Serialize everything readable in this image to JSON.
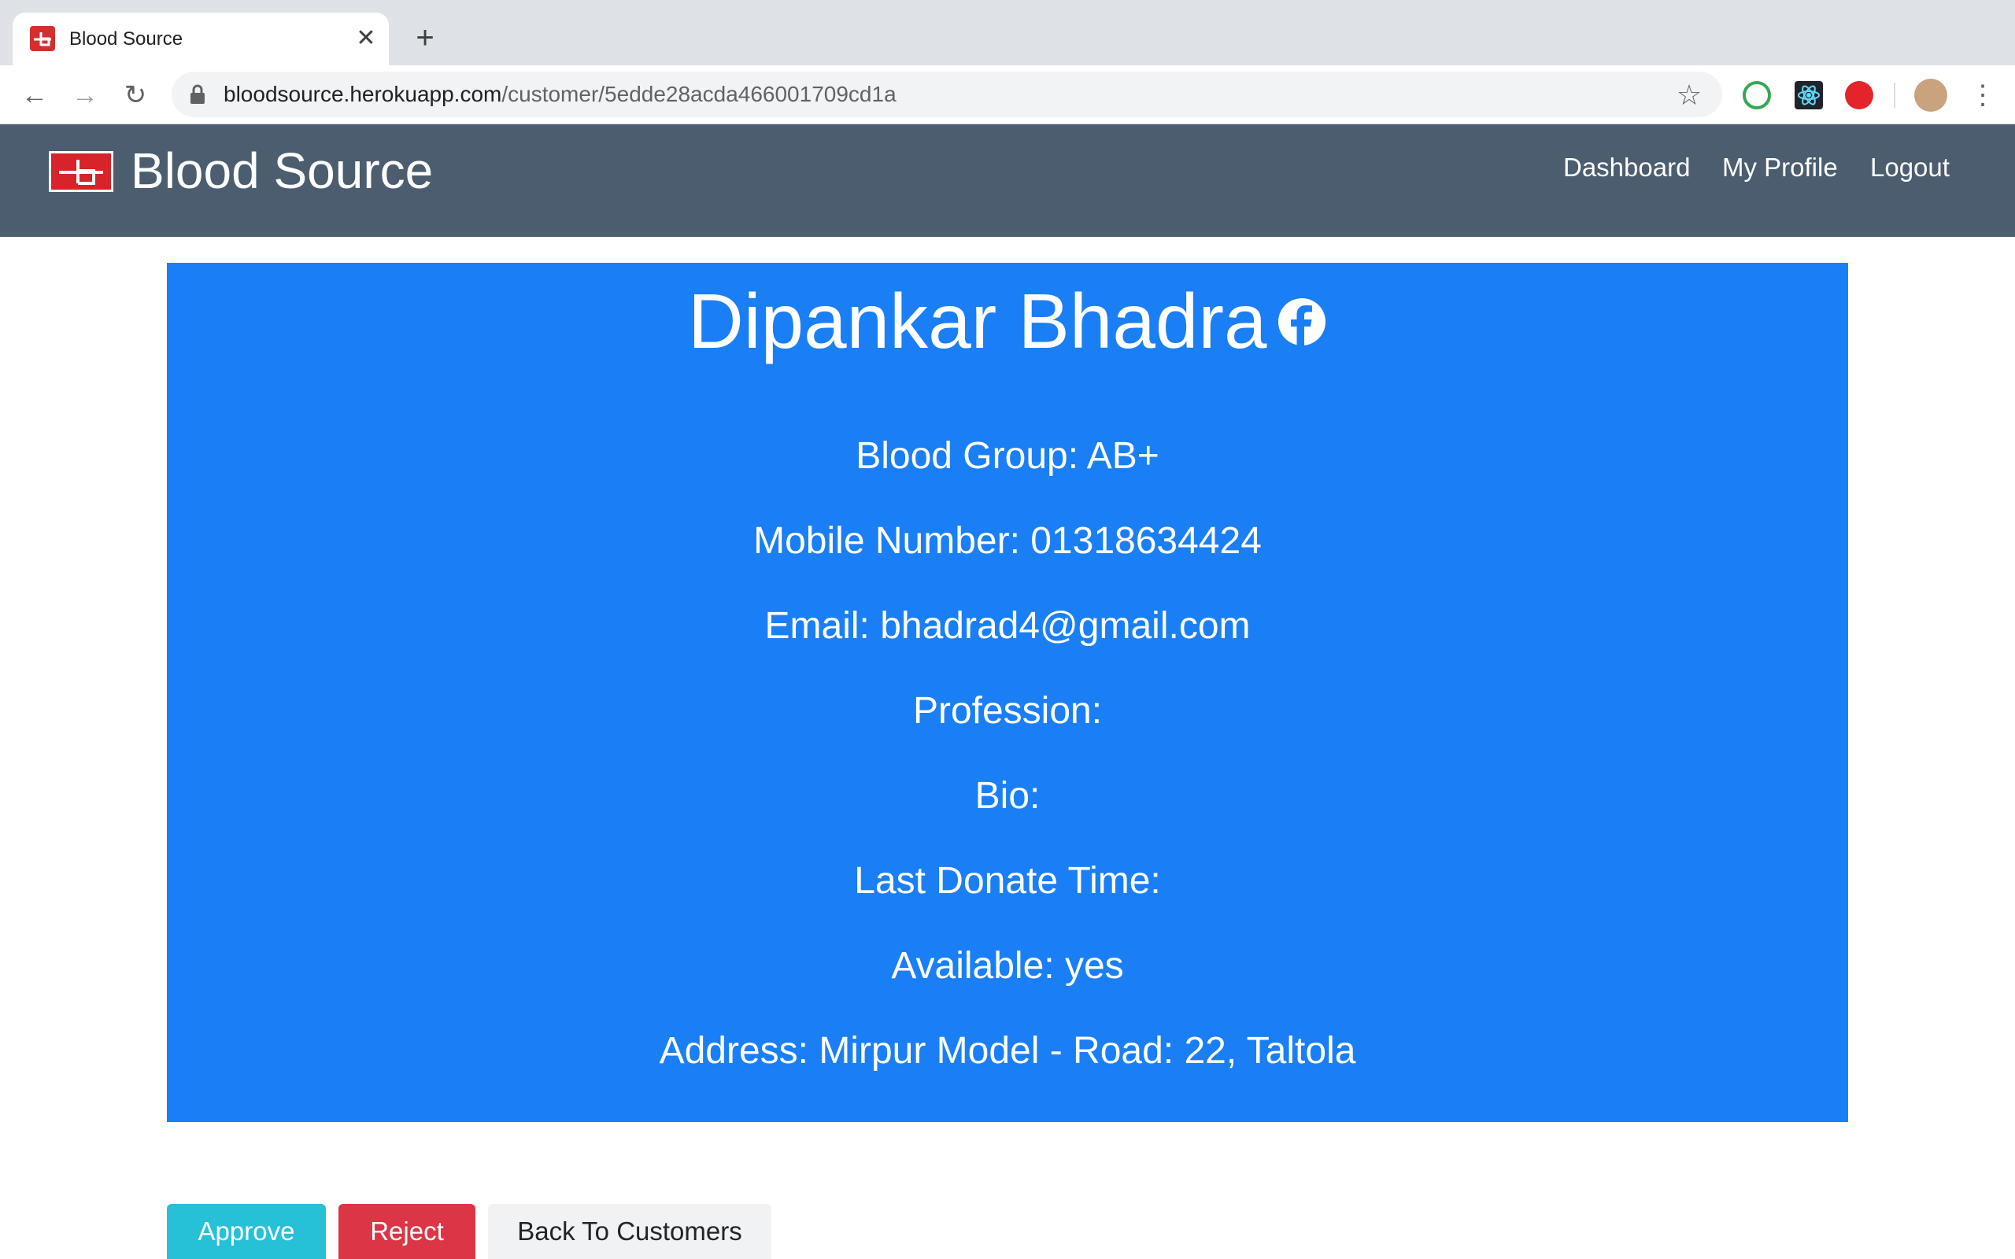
{
  "browser": {
    "tab_title": "Blood Source",
    "tab_close": "✕",
    "new_tab": "+",
    "url_host": "bloodsource.herokuapp.com",
    "url_path": "/customer/5edde28acda466001709cd1a",
    "back": "←",
    "forward": "→",
    "reload": "↻",
    "star": "☆",
    "menu": "⋮"
  },
  "navbar": {
    "brand": "Blood Source",
    "links": [
      "Dashboard",
      "My Profile",
      "Logout"
    ]
  },
  "profile": {
    "name": "Dipankar Bhadra",
    "fields": [
      "Blood Group: AB+",
      "Mobile Number: 01318634424",
      "Email: bhadrad4@gmail.com",
      "Profession:",
      "Bio:",
      "Last Donate Time:",
      "Available: yes",
      "Address: Mirpur Model - Road: 22, Taltola"
    ]
  },
  "actions": {
    "approve": "Approve",
    "reject": "Reject",
    "back": "Back To Customers"
  },
  "colors": {
    "navbar": "#4b5d6f",
    "card": "#1a7ff5",
    "approve": "#27c1d7",
    "reject": "#dc3545",
    "brand_logo": "#d7232a"
  }
}
